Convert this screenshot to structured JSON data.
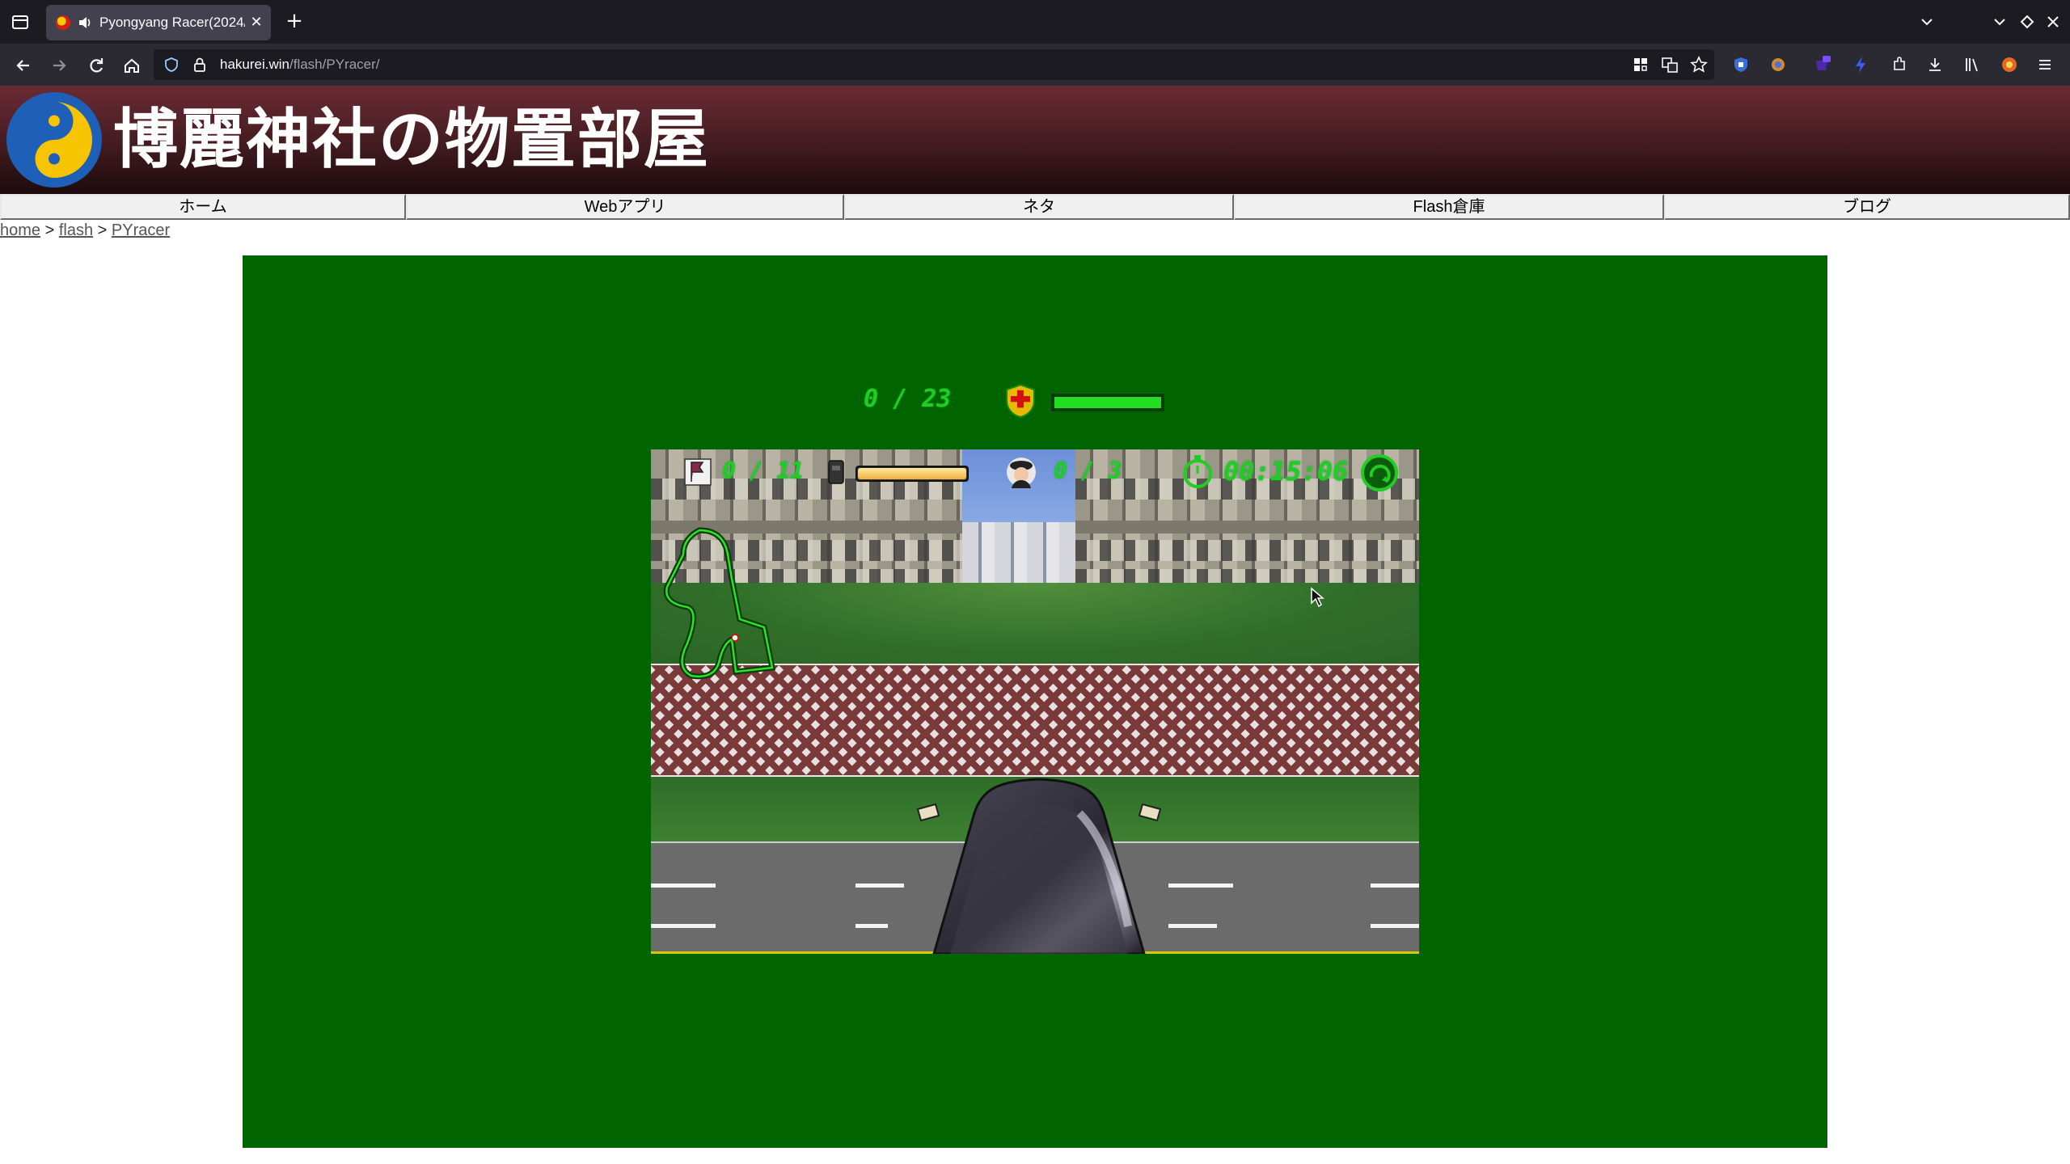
{
  "browser": {
    "tab": {
      "title": "Pyongyang Racer(2024/",
      "close_glyph": "✕"
    },
    "new_tab_glyph": "+",
    "url": {
      "host": "hakurei.win",
      "path": "/flash/PYracer/"
    }
  },
  "site": {
    "title": "博麗神社の物置部屋",
    "nav": [
      {
        "label": "ホーム"
      },
      {
        "label": "Webアプリ"
      },
      {
        "label": "ネタ"
      },
      {
        "label": "Flash倉庫"
      },
      {
        "label": "ブログ"
      }
    ],
    "breadcrumb": [
      {
        "label": "home"
      },
      {
        "label": "flash"
      },
      {
        "label": "PYracer"
      }
    ],
    "breadcrumb_separator": ">"
  },
  "game": {
    "fuel_counter": "0 / 23",
    "health_level": 1.0,
    "flag_counter": "0 / 11",
    "fuel_gauge_level": 1.0,
    "traffic_officer_counter": "0 / 3",
    "timer": "00:15:06"
  },
  "colors": {
    "flash_bg": "#006400",
    "hud_green": "#22cc22",
    "header_top": "#6b2a34",
    "header_bottom": "#1d0b0d"
  },
  "icons": {
    "tab_list": "tab-list-icon",
    "speaker": "speaker-icon",
    "back": "back-arrow-icon",
    "forward": "forward-arrow-icon",
    "reload": "reload-icon",
    "home": "home-icon",
    "shield": "tracking-protection-icon",
    "lock": "lock-icon",
    "health": "red-cross-shield-icon",
    "flag": "flag-icon",
    "fuel_can": "fuel-can-icon",
    "officer": "traffic-officer-icon",
    "stopwatch": "stopwatch-icon",
    "lap": "lap-arrow-icon"
  }
}
